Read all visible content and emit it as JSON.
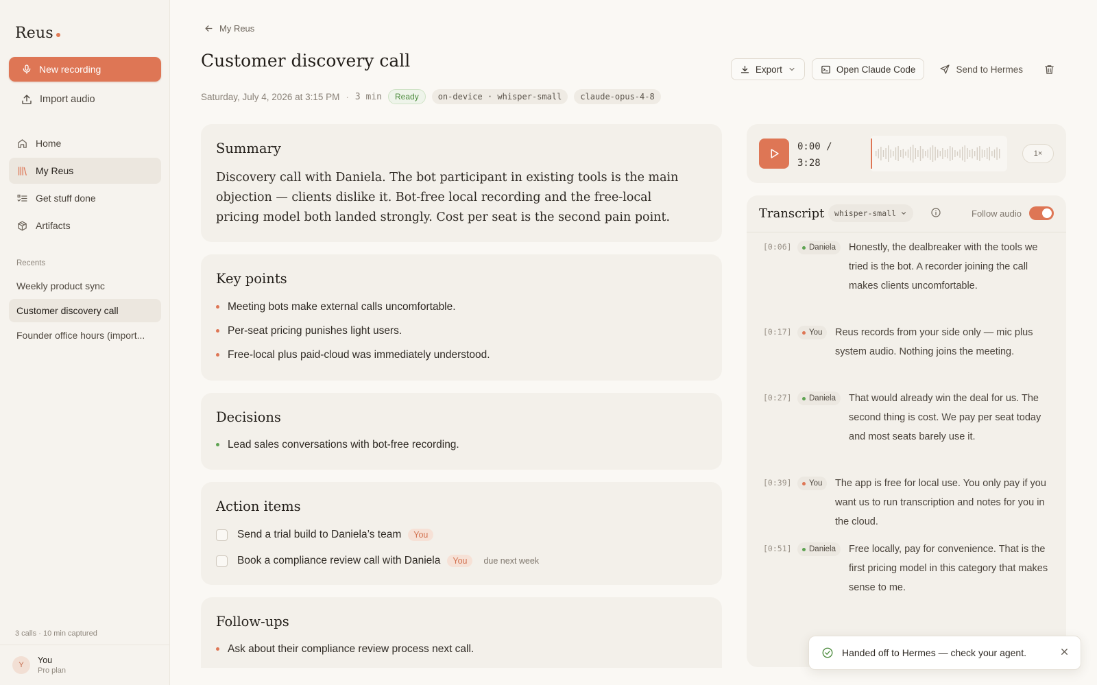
{
  "sidebar": {
    "logo": "Reus",
    "new_recording": "New recording",
    "import_audio": "Import audio",
    "nav": [
      {
        "label": "Home",
        "icon": "home-icon"
      },
      {
        "label": "My Reus",
        "icon": "library-icon"
      },
      {
        "label": "Get stuff done",
        "icon": "checklist-icon"
      },
      {
        "label": "Artifacts",
        "icon": "box-icon"
      }
    ],
    "recents_label": "Recents",
    "recents": [
      "Weekly product sync",
      "Customer discovery call",
      "Founder office hours (import..."
    ],
    "stats": "3 calls · 10 min captured",
    "user": {
      "initial": "Y",
      "name": "You",
      "plan": "Pro plan"
    }
  },
  "header": {
    "back": "My Reus",
    "title": "Customer discovery call",
    "date": "Saturday, July 4, 2026 at 3:15 PM",
    "duration": "3 min",
    "status": "Ready",
    "engine": "on-device · whisper-small",
    "model": "claude-opus-4-8",
    "export": "Export",
    "open_claude": "Open Claude Code",
    "send_hermes": "Send to Hermes"
  },
  "summary": {
    "title": "Summary",
    "text": "Discovery call with Daniela. The bot participant in existing tools is the main objection — clients dislike it. Bot-free local recording and the free-local pricing model both landed strongly. Cost per seat is the second pain point."
  },
  "key_points": {
    "title": "Key points",
    "items": [
      "Meeting bots make external calls uncomfortable.",
      "Per-seat pricing punishes light users.",
      "Free-local plus paid-cloud was immediately understood."
    ]
  },
  "decisions": {
    "title": "Decisions",
    "items": [
      "Lead sales conversations with bot-free recording."
    ]
  },
  "action_items": {
    "title": "Action items",
    "items": [
      {
        "text": "Send a trial build to Daniela’s team",
        "owner": "You",
        "due": ""
      },
      {
        "text": "Book a compliance review call with Daniela",
        "owner": "You",
        "due": "due next week"
      }
    ]
  },
  "follow_ups": {
    "title": "Follow-ups",
    "items": [
      "Ask about their compliance review process next call."
    ]
  },
  "player": {
    "current": "0:00 /",
    "total": "3:28",
    "speed": "1×",
    "progress": 0
  },
  "transcript": {
    "title": "Transcript",
    "model": "whisper-small",
    "follow_audio": "Follow audio",
    "follow_enabled": true,
    "segments": [
      {
        "ts": "[0:06]",
        "speaker": "Daniela",
        "text": "Honestly, the dealbreaker with the tools we tried is the bot. A recorder joining the call makes clients uncomfortable."
      },
      {
        "ts": "[0:17]",
        "speaker": "You",
        "text": "Reus records from your side only — mic plus system audio. Nothing joins the meeting."
      },
      {
        "ts": "[0:27]",
        "speaker": "Daniela",
        "text": "That would already win the deal for us. The second thing is cost. We pay per seat today and most seats barely use it."
      },
      {
        "ts": "[0:39]",
        "speaker": "You",
        "text": "The app is free for local use. You only pay if you want us to run transcription and notes for you in the cloud."
      },
      {
        "ts": "[0:51]",
        "speaker": "Daniela",
        "text": "Free locally, pay for convenience. That is the first pricing model in this category that makes sense to me."
      }
    ]
  },
  "toast": {
    "text": "Handed off to Hermes — check your agent."
  },
  "colors": {
    "accent": "#de7655",
    "ready_green": "#4a8a3b",
    "background": "#faf8f4",
    "card": "#f3f0ea"
  }
}
